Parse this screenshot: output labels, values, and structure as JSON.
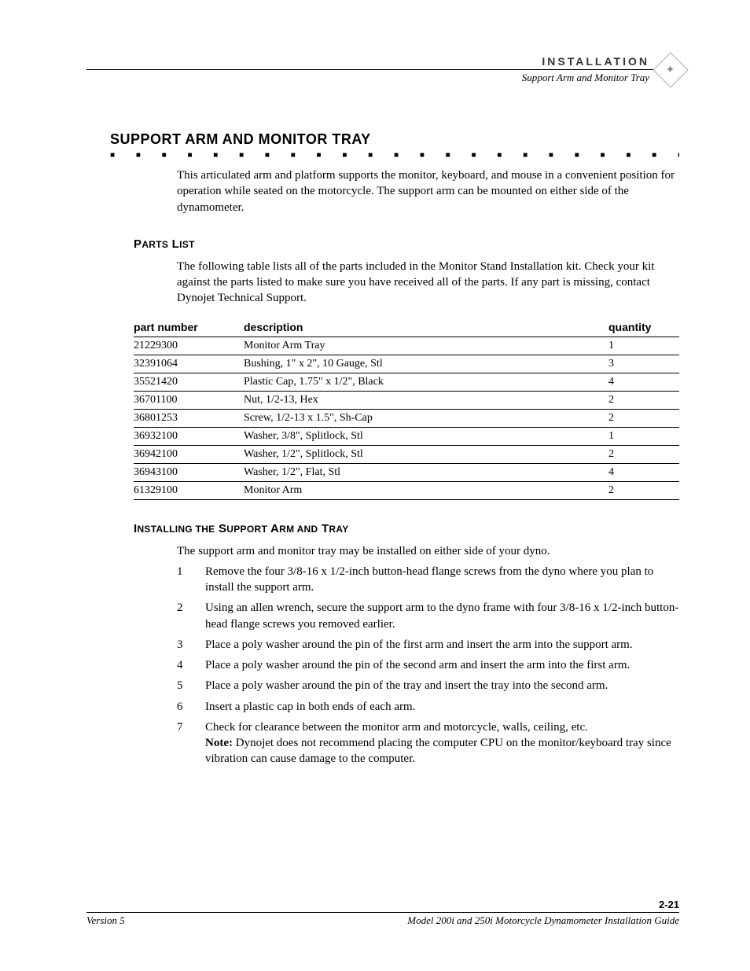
{
  "header": {
    "category": "INSTALLATION",
    "subtitle": "Support Arm and Monitor Tray"
  },
  "section": {
    "title": "SUPPORT ARM AND MONITOR TRAY",
    "dots": "■ ■ ■ ■ ■ ■ ■ ■ ■ ■ ■ ■ ■ ■ ■ ■ ■ ■ ■ ■ ■ ■ ■ ■ ■ ■ ■ ■ ■ ■ ■ ■ ■ ■ ■",
    "intro": "This articulated arm and platform supports the monitor, keyboard, and mouse in a convenient position for operation while seated on the motorcycle. The support arm can be mounted on either side of the dynamometer."
  },
  "parts_list": {
    "heading": "PARTS LIST",
    "intro": "The following table lists all of the parts included in the Monitor Stand Installation kit. Check your kit against the parts listed to make sure you have received all of the parts. If any part is missing, contact Dynojet Technical Support.",
    "columns": {
      "pn": "part number",
      "desc": "description",
      "qty": "quantity"
    },
    "rows": [
      {
        "pn": "21229300",
        "desc": "Monitor Arm Tray",
        "qty": "1"
      },
      {
        "pn": "32391064",
        "desc": "Bushing, 1\" x 2\", 10 Gauge, Stl",
        "qty": "3"
      },
      {
        "pn": "35521420",
        "desc": "Plastic Cap, 1.75\" x 1/2\", Black",
        "qty": "4"
      },
      {
        "pn": "36701100",
        "desc": "Nut, 1/2-13, Hex",
        "qty": "2"
      },
      {
        "pn": "36801253",
        "desc": "Screw, 1/2-13 x 1.5\", Sh-Cap",
        "qty": "2"
      },
      {
        "pn": "36932100",
        "desc": "Washer, 3/8\", Splitlock, Stl",
        "qty": "1"
      },
      {
        "pn": "36942100",
        "desc": "Washer, 1/2\", Splitlock, Stl",
        "qty": "2"
      },
      {
        "pn": "36943100",
        "desc": "Washer, 1/2\", Flat, Stl",
        "qty": "4"
      },
      {
        "pn": "61329100",
        "desc": "Monitor Arm",
        "qty": "2"
      }
    ]
  },
  "install": {
    "heading": "INSTALLING THE SUPPORT ARM AND TRAY",
    "intro": "The support arm and monitor tray may be installed on either side of your dyno.",
    "steps": [
      "Remove the four 3/8-16 x 1/2-inch button-head flange screws from the dyno where you plan to install the support arm.",
      "Using an allen wrench, secure the support arm to the dyno frame with four 3/8-16 x 1/2-inch button-head flange screws you removed earlier.",
      "Place a poly washer around the pin of the first arm and insert the arm into the support arm.",
      "Place a poly washer around the pin of the second arm and insert the arm into the first arm.",
      "Place a poly washer around the pin of the tray and insert the tray into the second arm.",
      "Insert a plastic cap in both ends of each arm.",
      "Check for clearance between the monitor arm and motorcycle, walls, ceiling, etc."
    ],
    "note_label": "Note:",
    "note_text": " Dynojet does not recommend placing the computer CPU on the monitor/keyboard tray since vibration can cause damage to the computer."
  },
  "footer": {
    "page": "2-21",
    "left": "Version 5",
    "right": "Model 200i and 250i Motorcycle Dynamometer Installation Guide"
  }
}
